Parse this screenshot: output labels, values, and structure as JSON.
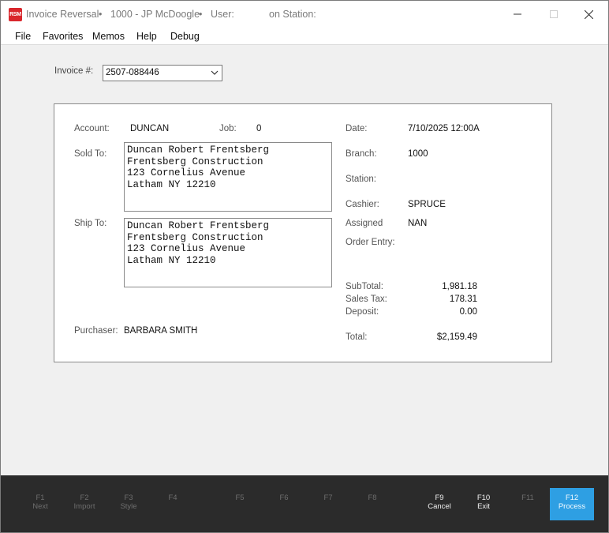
{
  "titlebar": {
    "logo": "RSM",
    "app_title": "Invoice Reversal",
    "sep1": "•",
    "store": "1000 - JP McDoogle",
    "sep2": "•",
    "user_label": "User:",
    "station_label": "on Station:"
  },
  "menu": {
    "items": [
      "File",
      "Favorites",
      "Memos",
      "Help",
      "Debug"
    ]
  },
  "invoice": {
    "label": "Invoice #:",
    "value": "2507-088446"
  },
  "details": {
    "account_label": "Account:",
    "account_value": "DUNCAN",
    "job_label": "Job:",
    "job_value": "0",
    "sold_to_label": "Sold To:",
    "sold_to_lines": [
      "Duncan Robert Frentsberg",
      "Frentsberg Construction",
      "123 Cornelius Avenue",
      "Latham NY 12210"
    ],
    "ship_to_label": "Ship To:",
    "ship_to_lines": [
      "Duncan Robert Frentsberg",
      "Frentsberg Construction",
      "123 Cornelius Avenue",
      "Latham NY 12210"
    ],
    "purchaser_label": "Purchaser:",
    "purchaser_value": "BARBARA SMITH",
    "date_label": "Date:",
    "date_value": "7/10/2025 12:00A",
    "branch_label": "Branch:",
    "branch_value": "1000",
    "station_label": "Station:",
    "cashier_label": "Cashier:",
    "cashier_value": "SPRUCE",
    "assigned_label": "Assigned",
    "assigned_value": "NAN",
    "order_entry_label": "Order Entry:",
    "subtotal_label": "SubTotal:",
    "subtotal_value": "1,981.18",
    "sales_tax_label": "Sales Tax:",
    "sales_tax_value": "178.31",
    "deposit_label": "Deposit:",
    "deposit_value": "0.00",
    "total_label": "Total:",
    "total_value": "$2,159.49"
  },
  "fkeys": [
    {
      "key": "F1",
      "label": "Next"
    },
    {
      "key": "F2",
      "label": "Import"
    },
    {
      "key": "F3",
      "label": "Style"
    },
    {
      "key": "F4",
      "label": ""
    },
    {
      "key": "F5",
      "label": ""
    },
    {
      "key": "F6",
      "label": ""
    },
    {
      "key": "F7",
      "label": ""
    },
    {
      "key": "F8",
      "label": ""
    },
    {
      "key": "F9",
      "label": "Cancel"
    },
    {
      "key": "F10",
      "label": "Exit"
    },
    {
      "key": "F11",
      "label": ""
    },
    {
      "key": "F12",
      "label": "Process"
    }
  ],
  "colors": {
    "logo_red": "#d9262c",
    "process_blue": "#2e9fe3",
    "fbar_bg": "#2b2b2b"
  }
}
